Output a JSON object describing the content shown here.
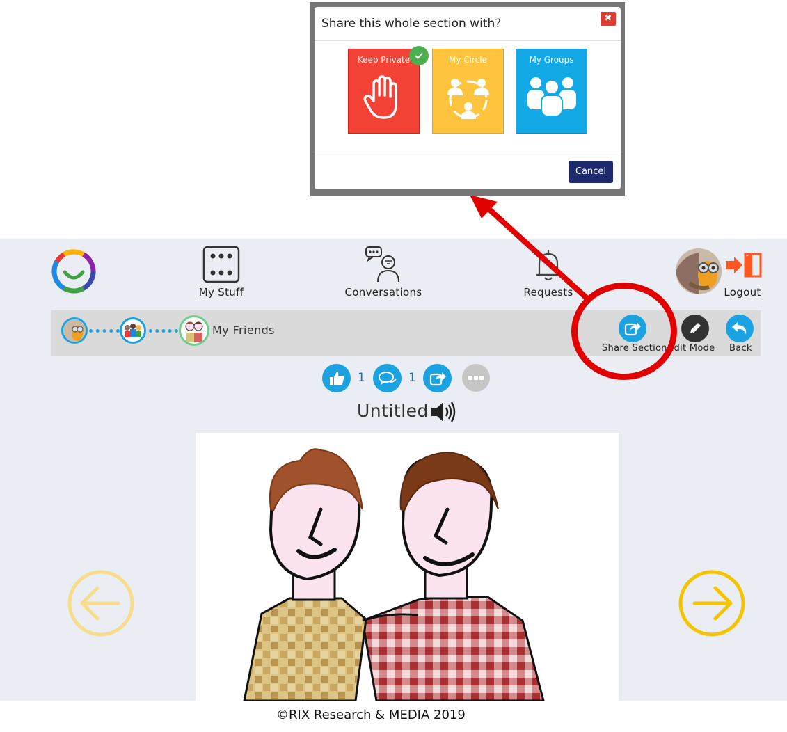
{
  "nav": {
    "my_stuff": "My Stuff",
    "conversations": "Conversations",
    "requests": "Requests",
    "logout": "Logout"
  },
  "breadcrumb": {
    "current": "My Friends"
  },
  "actions": {
    "share_section": "Share Section",
    "edit_mode": "Edit Mode",
    "back": "Back"
  },
  "stats": {
    "likes": "1",
    "comments": "1"
  },
  "page": {
    "title": "Untitled"
  },
  "modal": {
    "title": "Share this whole section with?",
    "options": [
      {
        "label": "Keep Private",
        "color": "#f44336",
        "selected": true
      },
      {
        "label": "My Circle",
        "color": "#ffc43d",
        "selected": false
      },
      {
        "label": "My Groups",
        "color": "#12a9e6",
        "selected": false
      }
    ],
    "cancel": "Cancel",
    "close": "✖"
  },
  "footer": {
    "copyright": "©RIX  Research & MEDIA 2019"
  },
  "colors": {
    "accent_blue": "#1aa3e0",
    "annotation_red": "#e00000",
    "arrow_yellow": "#f5c400",
    "cancel_navy": "#1d2a6b"
  }
}
